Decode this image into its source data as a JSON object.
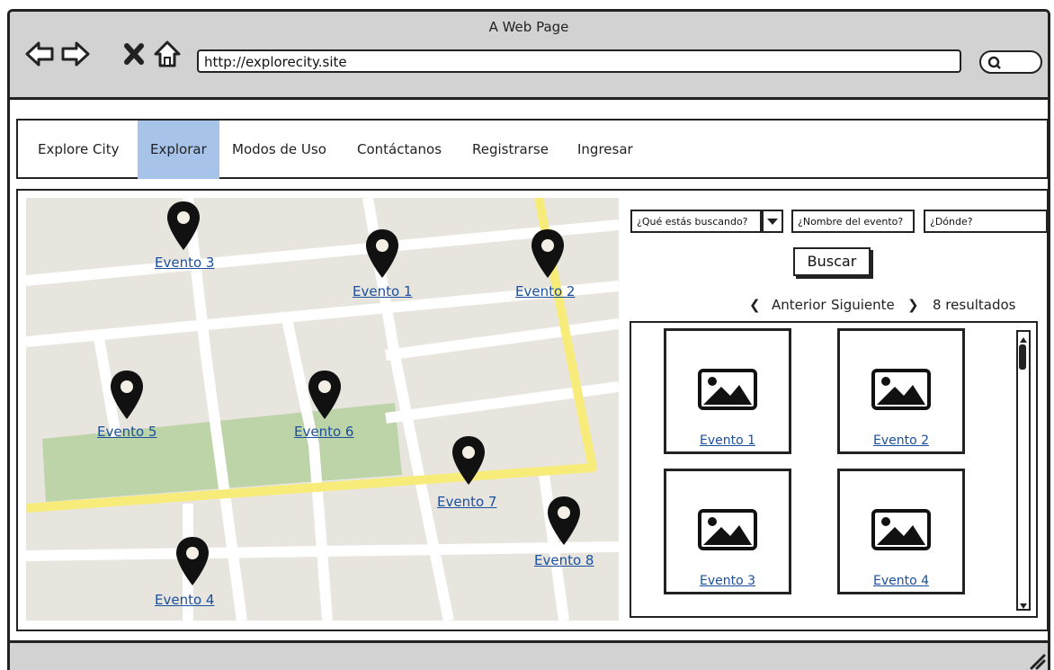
{
  "window": {
    "title": "A Web Page"
  },
  "browser": {
    "url": "http://explorecity.site",
    "icons": [
      "back-arrow-icon",
      "forward-arrow-icon",
      "close-x-icon",
      "home-icon",
      "search-icon"
    ]
  },
  "nav": {
    "items": [
      {
        "label": "Explore City",
        "active": false
      },
      {
        "label": "Explorar",
        "active": true
      },
      {
        "label": "Modos de Uso",
        "active": false
      },
      {
        "label": "Contáctanos",
        "active": false
      },
      {
        "label": "Registrarse",
        "active": false
      },
      {
        "label": "Ingresar",
        "active": false
      }
    ]
  },
  "map": {
    "markers": [
      {
        "label": "Evento 3"
      },
      {
        "label": "Evento 1"
      },
      {
        "label": "Evento 2"
      },
      {
        "label": "Evento 5"
      },
      {
        "label": "Evento 6"
      },
      {
        "label": "Evento 7"
      },
      {
        "label": "Evento 8"
      },
      {
        "label": "Evento 4"
      }
    ]
  },
  "search": {
    "what_placeholder": "¿Qué estás buscando?",
    "name_placeholder": "¿Nombre del evento?",
    "where_placeholder": "¿Dónde?",
    "button_label": "Buscar"
  },
  "pager": {
    "prev_label": "Anterior",
    "next_label": "Siguiente",
    "count_text": "8 resultados"
  },
  "results": {
    "cards": [
      {
        "label": "Evento 1"
      },
      {
        "label": "Evento 2"
      },
      {
        "label": "Evento 3"
      },
      {
        "label": "Evento 4"
      }
    ]
  },
  "colors": {
    "active_nav": "#a7c3ea",
    "map_background": "#e8e5df",
    "park": "#bdd3a8",
    "main_road": "#f7ec7a",
    "link": "#1a4f9e"
  }
}
